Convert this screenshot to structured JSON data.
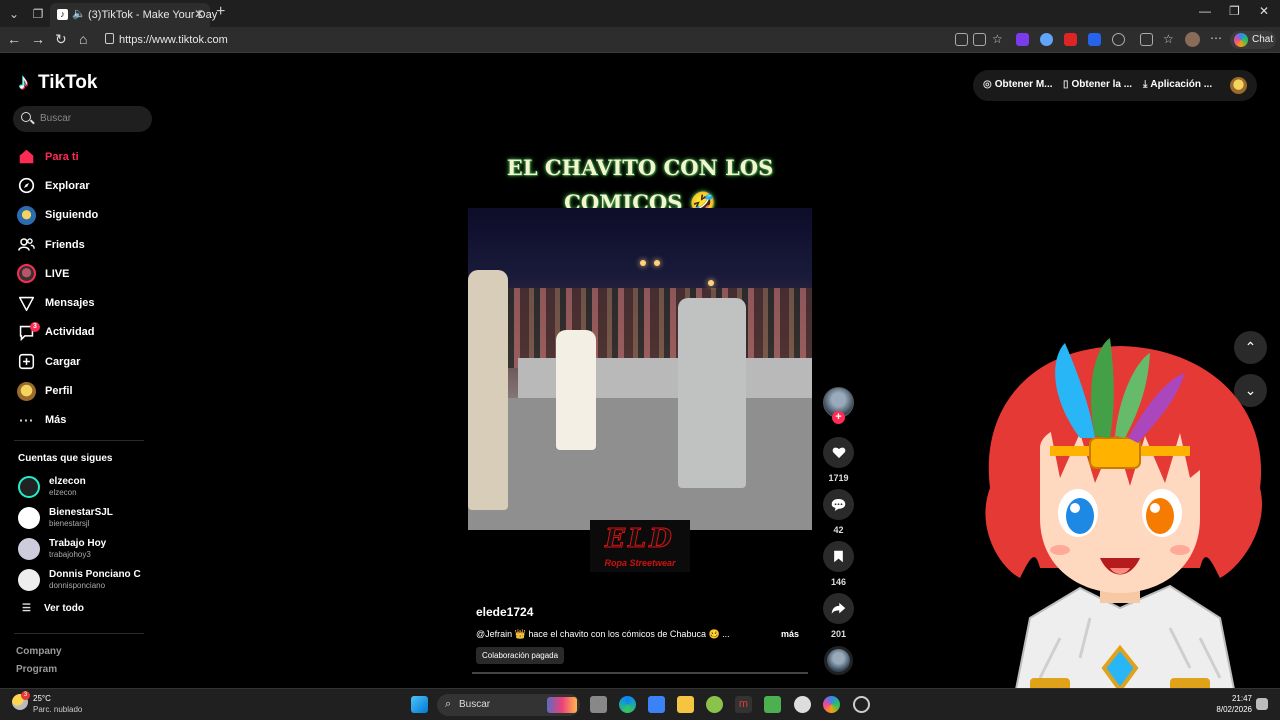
{
  "browser": {
    "tab_title": "(3)TikTok - Make Your Day",
    "url": "https://www.tiktok.com",
    "chat_label": "Chat"
  },
  "tiktok": {
    "logo_text": "TikTok",
    "search_placeholder": "Buscar",
    "menu": [
      {
        "label": "Para ti",
        "icon": "home-icon",
        "active": true
      },
      {
        "label": "Explorar",
        "icon": "compass-icon"
      },
      {
        "label": "Siguiendo",
        "icon": "following-avatar-icon"
      },
      {
        "label": "Friends",
        "icon": "friends-icon"
      },
      {
        "label": "LIVE",
        "icon": "live-icon"
      },
      {
        "label": "Mensajes",
        "icon": "send-icon"
      },
      {
        "label": "Actividad",
        "icon": "activity-icon",
        "badge": "3"
      },
      {
        "label": "Cargar",
        "icon": "upload-icon"
      },
      {
        "label": "Perfil",
        "icon": "profile-avatar-icon"
      },
      {
        "label": "Más",
        "icon": "more-icon"
      }
    ],
    "following_title": "Cuentas que sigues",
    "following": [
      {
        "name": "elzecon",
        "handle": "elzecon"
      },
      {
        "name": "BienestarSJL",
        "handle": "bienestarsjl"
      },
      {
        "name": "Trabajo Hoy",
        "handle": "trabajohoy3"
      },
      {
        "name": "Donnis Ponciano C",
        "handle": "donnisponciano"
      }
    ],
    "see_all": "Ver todo",
    "footer": [
      "Company",
      "Program"
    ],
    "header": {
      "coins": "Obtener M...",
      "get_app": "Obtener la ...",
      "desktop_app": "Aplicación ..."
    }
  },
  "video": {
    "overlay_title_line1": "EL CHAVITO CON LOS",
    "overlay_title_line2": "COMICOS 🤣",
    "brand_big": "ELD",
    "brand_sub": "Ropa Streetwear",
    "author": "elede1724",
    "description": "@Jefrain 👑 hace el chavito con los cómicos de Chabuca 🥴 ...",
    "more": "más",
    "paid_tag": "Colaboración pagada",
    "likes": "1719",
    "comments": "42",
    "saves": "146",
    "shares": "201"
  },
  "taskbar": {
    "temperature": "25°C",
    "weather": "Parc. nublado",
    "weather_badge": "3",
    "search": "Buscar",
    "time": "21:47",
    "date": "8/02/2026"
  }
}
